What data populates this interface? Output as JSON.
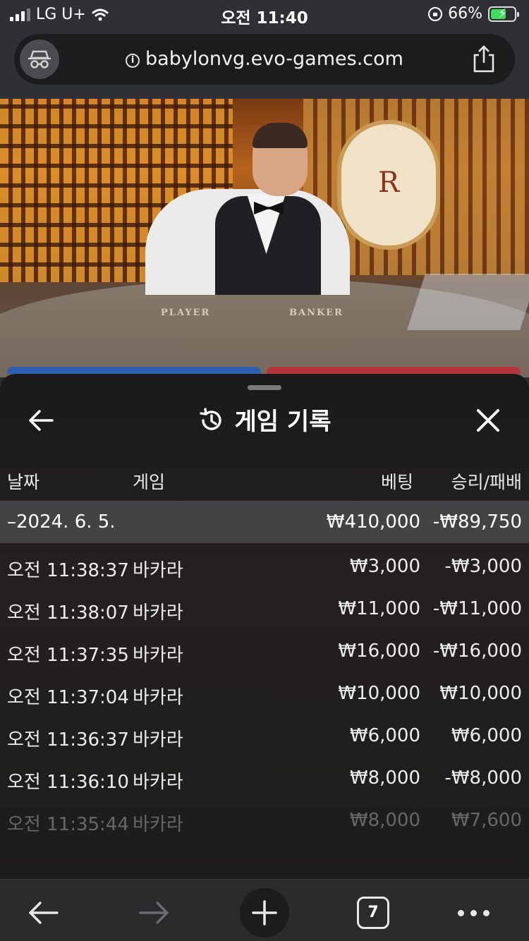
{
  "status_bar": {
    "carrier": "LG U+",
    "time": "오전 11:40",
    "battery_percent": "66%",
    "battery_level": 0.66,
    "battery_color": "#3ddc5a"
  },
  "browser": {
    "url": "babylonvg.evo-games.com",
    "incognito_icon": "incognito-icon",
    "share_icon": "share-icon",
    "tab_count": "7"
  },
  "table_labels": {
    "player": "PLAYER",
    "banker": "BANKER",
    "emblem": "R"
  },
  "history": {
    "title": "게임 기록",
    "columns": {
      "date": "날짜",
      "game": "게임",
      "bet": "베팅",
      "win_loss": "승리/패배"
    },
    "day_group": {
      "date": "–2024. 6. 5.",
      "bet_total": "₩410,000",
      "win_loss_total": "-₩89,750"
    },
    "rows": [
      {
        "time": "오전 11:38:37",
        "game": "바카라",
        "bet": "₩3,000",
        "result": "-₩3,000"
      },
      {
        "time": "오전 11:38:07",
        "game": "바카라",
        "bet": "₩11,000",
        "result": "-₩11,000"
      },
      {
        "time": "오전 11:37:35",
        "game": "바카라",
        "bet": "₩16,000",
        "result": "-₩16,000"
      },
      {
        "time": "오전 11:37:04",
        "game": "바카라",
        "bet": "₩10,000",
        "result": "₩10,000"
      },
      {
        "time": "오전 11:36:37",
        "game": "바카라",
        "bet": "₩6,000",
        "result": "₩6,000"
      },
      {
        "time": "오전 11:36:10",
        "game": "바카라",
        "bet": "₩8,000",
        "result": "-₩8,000"
      },
      {
        "time": "오전 11:35:44",
        "game": "바카라",
        "bet": "₩8,000",
        "result": "₩7,600"
      }
    ]
  }
}
